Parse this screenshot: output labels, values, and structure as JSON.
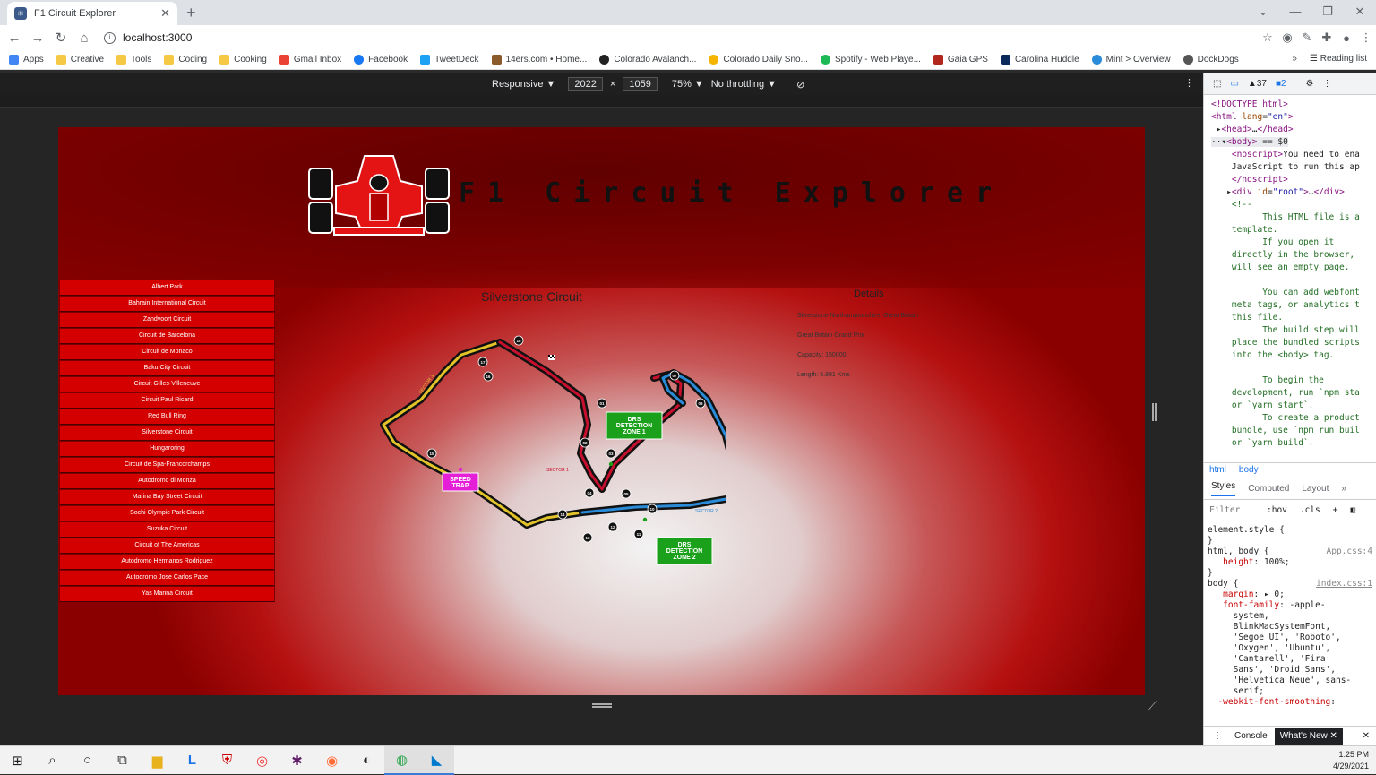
{
  "browser": {
    "tab_title": "F1 Circuit Explorer",
    "url": "localhost:3000",
    "bookmarks": [
      "Apps",
      "Creative",
      "Tools",
      "Coding",
      "Cooking",
      "Gmail Inbox",
      "Facebook",
      "TweetDeck",
      "14ers.com • Home...",
      "Colorado Avalanch...",
      "Colorado Daily Sno...",
      "Spotify - Web Playe...",
      "Gaia GPS",
      "Carolina Huddle",
      "Mint > Overview",
      "DockDogs"
    ],
    "bookmark_more": "»",
    "reading_list": "Reading list"
  },
  "device_toolbar": {
    "mode": "Responsive ▼",
    "width": "2022",
    "times": "×",
    "height": "1059",
    "zoom": "75% ▼",
    "throttle": "No throttling ▼"
  },
  "app": {
    "title": "F1 Circuit Explorer",
    "circuits": [
      "Albert Park",
      "Bahrain International Circuit",
      "Zandvoort Circuit",
      "Circuit de Barcelona",
      "Circuit de Monaco",
      "Baku City Circuit",
      "Circuit Gilles-Villeneuve",
      "Circuit Paul Ricard",
      "Red Bull Ring",
      "Silverstone Circuit",
      "Hungaroring",
      "Circuit de Spa-Francorchamps",
      "Autodromo di Monza",
      "Marina Bay Street Circuit",
      "Sochi Olympic Park Circuit",
      "Suzuka Circuit",
      "Circuit of The Americas",
      "Autodromo Hermanos Rodriguez",
      "Autodromo Jose Carlos Pace",
      "Yas Marina Circuit"
    ],
    "selected_circuit": "Silverstone Circuit",
    "details_heading": "Details",
    "details": {
      "location": "Silverstone Northamptonshire, Great Britain",
      "race": "Great Britain Grand Prix",
      "capacity": "Capacity: 150000",
      "length": "Length: 5.891 Kms"
    },
    "map_labels": {
      "drs1_line1": "DRS",
      "drs1_line2": "DETECTION",
      "drs1_line3": "ZONE 1",
      "drs2_line1": "DRS",
      "drs2_line2": "DETECTION",
      "drs2_line3": "ZONE 2",
      "speed1": "SPEED",
      "speed2": "TRAP",
      "sector1": "SECTOR 1",
      "sector2": "SECTOR 2",
      "sector3": "SECTOR 3"
    },
    "turns": [
      "01",
      "02",
      "03",
      "04",
      "05",
      "06",
      "07",
      "08",
      "09",
      "10",
      "11",
      "12",
      "13",
      "14",
      "15",
      "16",
      "17",
      "18"
    ]
  },
  "devtools": {
    "warnings": "37",
    "issues": "2",
    "crumbs": [
      "html",
      "body"
    ],
    "style_tabs": [
      "Styles",
      "Computed",
      "Layout",
      "»"
    ],
    "filter": "Filter",
    "hov": ":hov",
    "cls": ".cls",
    "element_style": "element.style {",
    "rule1_sel": "html, body {",
    "rule1_src": "App.css:4",
    "rule1_prop": "height",
    "rule1_val": "100%;",
    "rule2_sel": "body {",
    "rule2_src": "index.css:1",
    "bottom_console": "Console",
    "bottom_whatsnew": "What's New"
  },
  "taskbar": {
    "time": "1:25 PM",
    "date": "4/29/2021"
  }
}
